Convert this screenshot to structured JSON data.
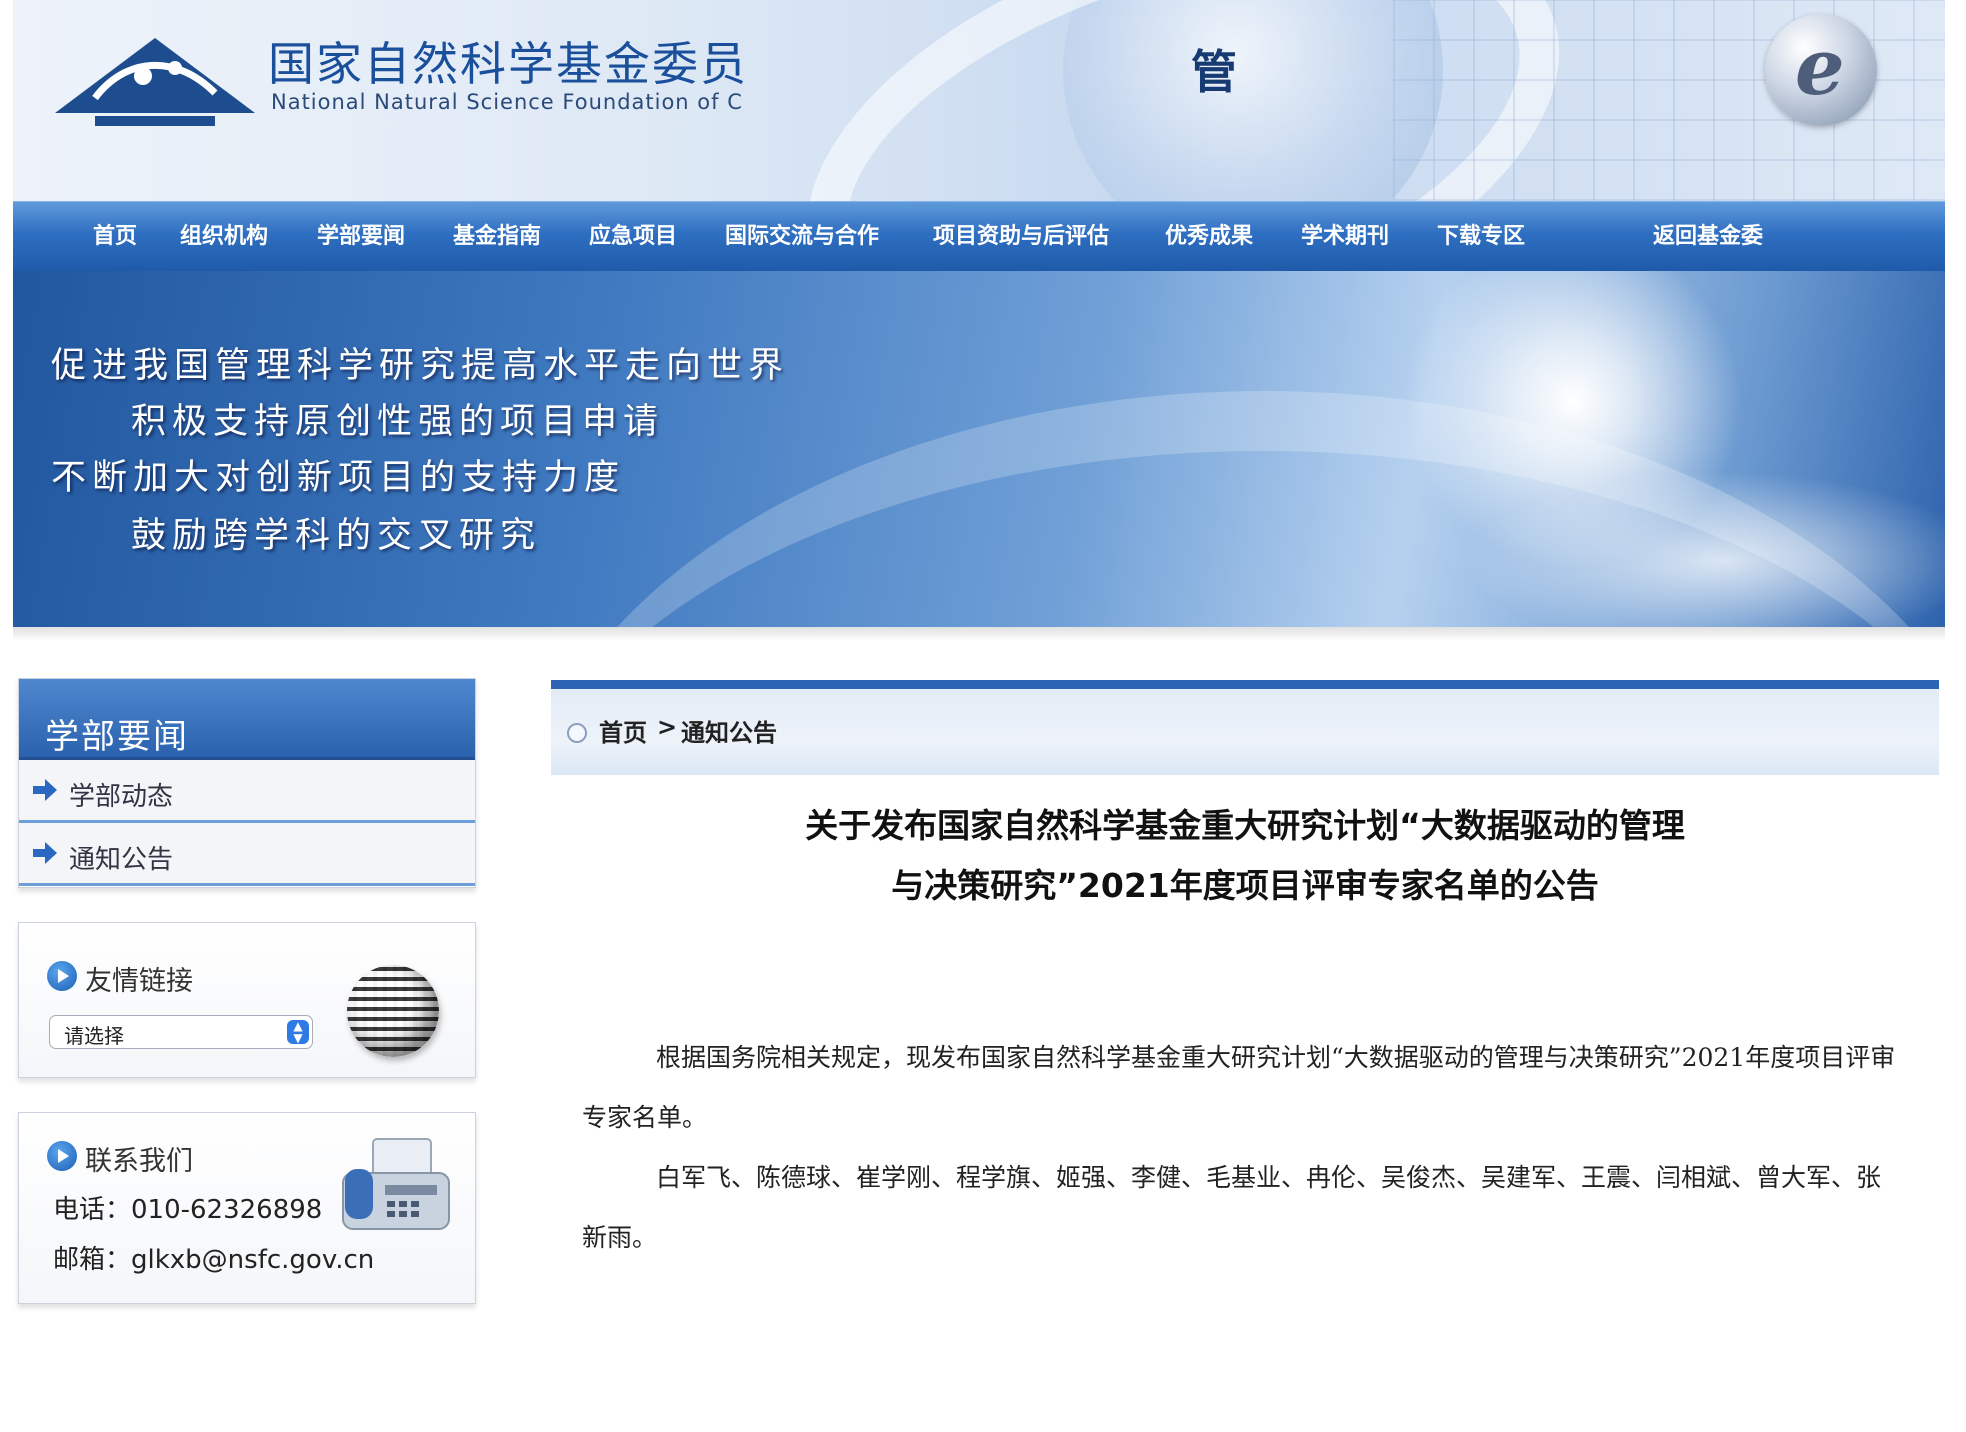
{
  "header": {
    "title_cn": "国家自然科学基金委员",
    "title_en": "National Natural Science Foundation of C",
    "right_char": "管",
    "logo_icon": "nsfc-logo-icon",
    "e_logo_letter": "e"
  },
  "nav": {
    "items": [
      {
        "label": "首页"
      },
      {
        "label": "组织机构"
      },
      {
        "label": "学部要闻"
      },
      {
        "label": "基金指南"
      },
      {
        "label": "应急项目"
      },
      {
        "label": "国际交流与合作"
      },
      {
        "label": "项目资助与后评估"
      },
      {
        "label": "优秀成果"
      },
      {
        "label": "学术期刊"
      },
      {
        "label": "下载专区"
      },
      {
        "label": "返回基金委"
      }
    ]
  },
  "banner": {
    "slogans": [
      "促进我国管理科学研究提高水平走向世界",
      "积极支持原创性强的项目申请",
      "不断加大对创新项目的支持力度",
      "鼓励跨学科的交叉研究"
    ]
  },
  "sidebar": {
    "news": {
      "title": "学部要闻",
      "links": [
        {
          "label": "学部动态"
        },
        {
          "label": "通知公告"
        }
      ]
    },
    "friend_links": {
      "title": "友情链接",
      "select_value": "请选择"
    },
    "contact": {
      "title": "联系我们",
      "phone": "电话：010-62326898",
      "email": "邮箱：glkxb@nsfc.gov.cn"
    }
  },
  "breadcrumb": {
    "home": "首页",
    "separator": ">",
    "current": "通知公告"
  },
  "article": {
    "title": "关于发布国家自然科学基金重大研究计划“大数据驱动的管理与决策研究”2021年度项目评审专家名单的公告",
    "paragraphs": [
      "根据国务院相关规定，现发布国家自然科学基金重大研究计划“大数据驱动的管理与决策研究”2021年度项目评审专家名单。",
      "白军飞、陈德球、崔学刚、程学旗、姬强、李健、毛基业、冉伦、吴俊杰、吴建军、王震、闫相斌、曾大军、张新雨。"
    ]
  },
  "colors": {
    "nav_blue": "#2f6fc1",
    "title_blue": "#1a4f9c",
    "accent_blue": "#2d63b3"
  }
}
